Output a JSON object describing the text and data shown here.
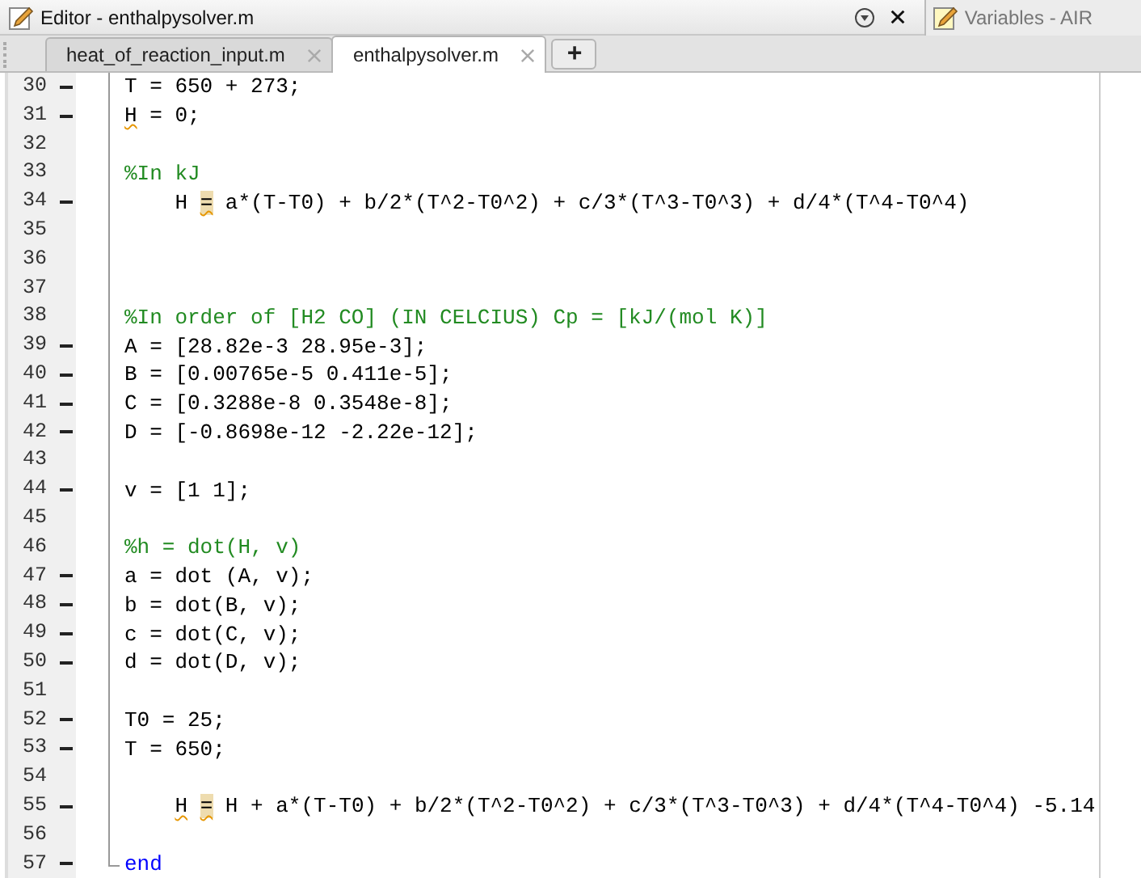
{
  "window": {
    "title": "Editor - enthalpysolver.m"
  },
  "side_panel": {
    "title": "Variables - AIR"
  },
  "tabs": [
    {
      "label": "heat_of_reaction_input.m",
      "selected": false
    },
    {
      "label": "enthalpysolver.m",
      "selected": true
    }
  ],
  "new_tab": "+",
  "lines": [
    {
      "number": "30",
      "executable": true,
      "indented": false,
      "segments": [
        {
          "kind": "code",
          "text": "T = 650 + 273;"
        }
      ]
    },
    {
      "number": "31",
      "executable": true,
      "indented": false,
      "segments": [
        {
          "kind": "warning",
          "text": "H"
        },
        {
          "kind": "code",
          "text": " = 0;"
        }
      ]
    },
    {
      "number": "32",
      "executable": false,
      "indented": false
    },
    {
      "number": "33",
      "executable": false,
      "indented": false,
      "segments": [
        {
          "kind": "comment",
          "text": "%In kJ"
        }
      ]
    },
    {
      "number": "34",
      "executable": true,
      "indented": true,
      "segments": [
        {
          "kind": "code",
          "text": "H "
        },
        {
          "kind": "match",
          "text": "="
        },
        {
          "kind": "code",
          "text": " a*(T-T0) + b/2*(T^2-T0^2) + c/3*(T^3-T0^3) + d/4*(T^4-T0^4)"
        }
      ]
    },
    {
      "number": "35",
      "executable": false,
      "indented": false
    },
    {
      "number": "36",
      "executable": false,
      "indented": false
    },
    {
      "number": "37",
      "executable": false,
      "indented": false
    },
    {
      "number": "38",
      "executable": false,
      "indented": false,
      "segments": [
        {
          "kind": "comment",
          "text": "%In order of [H2 CO] (IN CELCIUS) Cp = [kJ/(mol K)]"
        }
      ]
    },
    {
      "number": "39",
      "executable": true,
      "indented": false,
      "segments": [
        {
          "kind": "code",
          "text": "A = [28.82e-3 28.95e-3];"
        }
      ]
    },
    {
      "number": "40",
      "executable": true,
      "indented": false,
      "segments": [
        {
          "kind": "code",
          "text": "B = [0.00765e-5 0.411e-5];"
        }
      ]
    },
    {
      "number": "41",
      "executable": true,
      "indented": false,
      "segments": [
        {
          "kind": "code",
          "text": "C = [0.3288e-8 0.3548e-8];"
        }
      ]
    },
    {
      "number": "42",
      "executable": true,
      "indented": false,
      "segments": [
        {
          "kind": "code",
          "text": "D = [-0.8698e-12 -2.22e-12];"
        }
      ]
    },
    {
      "number": "43",
      "executable": false,
      "indented": false
    },
    {
      "number": "44",
      "executable": true,
      "indented": false,
      "segments": [
        {
          "kind": "code",
          "text": "v = [1 1];"
        }
      ]
    },
    {
      "number": "45",
      "executable": false,
      "indented": false
    },
    {
      "number": "46",
      "executable": false,
      "indented": false,
      "segments": [
        {
          "kind": "comment",
          "text": "%h = dot(H, v)"
        }
      ]
    },
    {
      "number": "47",
      "executable": true,
      "indented": false,
      "segments": [
        {
          "kind": "code",
          "text": "a = dot (A, v);"
        }
      ]
    },
    {
      "number": "48",
      "executable": true,
      "indented": false,
      "segments": [
        {
          "kind": "code",
          "text": "b = dot(B, v);"
        }
      ]
    },
    {
      "number": "49",
      "executable": true,
      "indented": false,
      "segments": [
        {
          "kind": "code",
          "text": "c = dot(C, v);"
        }
      ]
    },
    {
      "number": "50",
      "executable": true,
      "indented": false,
      "segments": [
        {
          "kind": "code",
          "text": "d = dot(D, v);"
        }
      ]
    },
    {
      "number": "51",
      "executable": false,
      "indented": false
    },
    {
      "number": "52",
      "executable": true,
      "indented": false,
      "segments": [
        {
          "kind": "code",
          "text": "T0 = 25;"
        }
      ]
    },
    {
      "number": "53",
      "executable": true,
      "indented": false,
      "segments": [
        {
          "kind": "code",
          "text": "T = 650;"
        }
      ]
    },
    {
      "number": "54",
      "executable": false,
      "indented": false
    },
    {
      "number": "55",
      "executable": true,
      "indented": true,
      "segments": [
        {
          "kind": "warning",
          "text": "H"
        },
        {
          "kind": "match",
          "text": "="
        },
        {
          "kind": "code",
          "text": " H + a*(T-T0) + b/2*(T^2-T0^2) + c/3*(T^3-T0^3) + d/4*(T^4-T0^4) -5.14"
        }
      ]
    },
    {
      "number": "56",
      "executable": false,
      "indented": false
    },
    {
      "number": "57",
      "executable": true,
      "indented": false,
      "segments": [
        {
          "kind": "keyword",
          "text": "end"
        }
      ]
    }
  ]
}
